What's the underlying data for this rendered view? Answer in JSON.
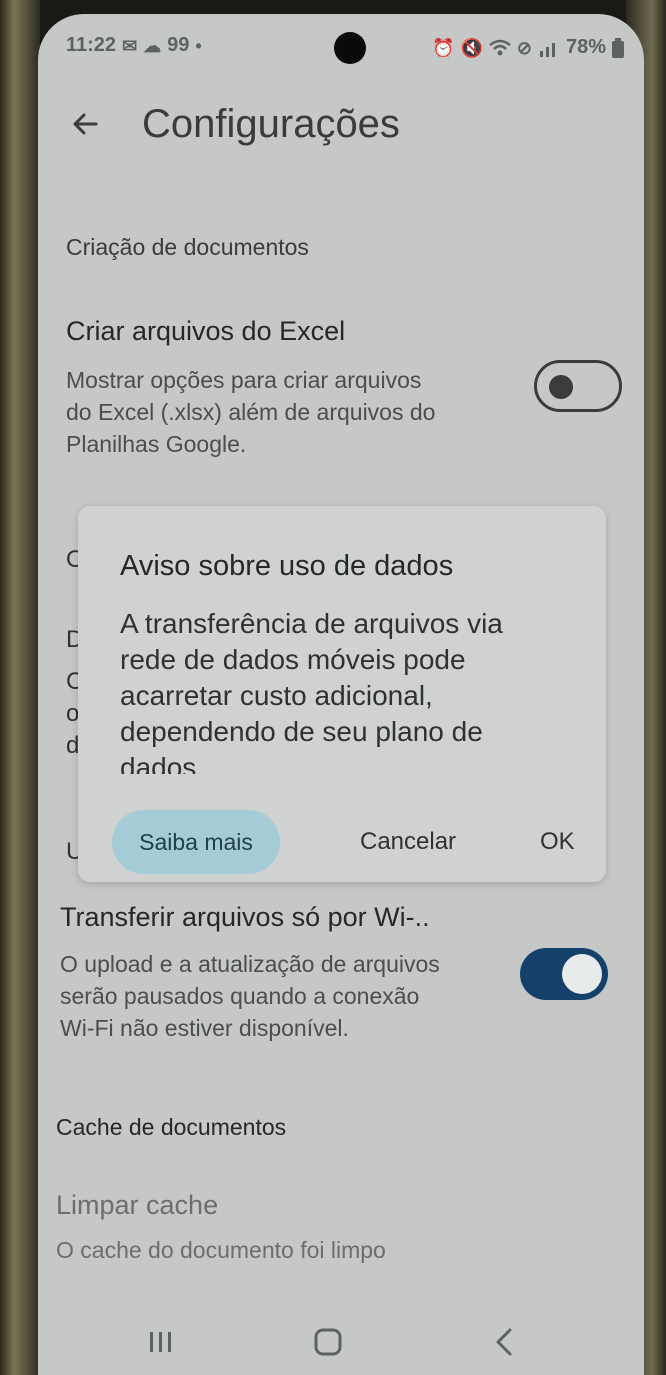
{
  "status_bar": {
    "time": "11:22",
    "temp": "99",
    "battery": "78%"
  },
  "header": {
    "title": "Configurações"
  },
  "sections": {
    "documents_header": "Criação de documentos",
    "cache_header": "Cache de documentos"
  },
  "excel_setting": {
    "title": "Criar arquivos do Excel",
    "description": [
      "Mostrar opções para criar arquivos",
      "do Excel (.xlsx) além de arquivos do",
      "Planilhas Google."
    ],
    "enabled": false
  },
  "partial_items": {
    "o1": "O",
    "d": "D",
    "c": "C",
    "o2": "o",
    "d2": "d",
    "u": "U"
  },
  "wifi_setting": {
    "title": "Transferir arquivos só por Wi-..",
    "description": [
      "O upload e a atualização de arquivos",
      "serão pausados quando a conexão",
      "Wi-Fi não estiver disponível."
    ],
    "enabled": true
  },
  "clear_cache": {
    "title": "Limpar cache",
    "description": "O cache do documento foi limpo"
  },
  "dialog": {
    "title": "Aviso sobre uso de dados",
    "body": [
      "A transferência de arquivos via",
      "rede de dados móveis pode",
      "acarretar custo adicional,",
      "dependendo de seu plano de",
      "dados."
    ],
    "learn_more": "Saiba mais",
    "cancel": "Cancelar",
    "ok": "OK"
  },
  "colors": {
    "toggle_on": "#15406a",
    "learn_more_bg": "#a5ccd6",
    "background": "#c6c8c7"
  }
}
